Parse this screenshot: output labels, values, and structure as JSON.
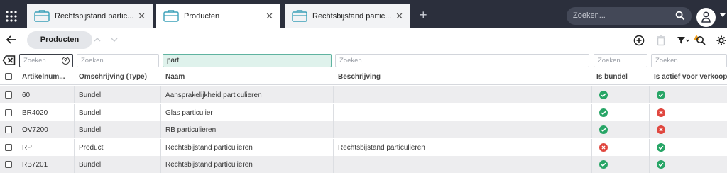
{
  "tabs": [
    {
      "label": "Rechtsbijstand partic...",
      "active": false
    },
    {
      "label": "Producten",
      "active": true
    },
    {
      "label": "Rechtsbijstand partic...",
      "active": false
    }
  ],
  "search": {
    "placeholder": "Zoeken..."
  },
  "toolbar": {
    "title": "Producten"
  },
  "filters": {
    "placeholder": "Zoeken...",
    "naam_value": "part"
  },
  "columns": [
    {
      "label": "Artikelnum..."
    },
    {
      "label": "Omschrijving (Type)"
    },
    {
      "label": "Naam"
    },
    {
      "label": "Beschrijving"
    },
    {
      "label": "Is bundel"
    },
    {
      "label": "Is actief voor verkoop"
    }
  ],
  "rows": [
    {
      "artikelnummer": "60",
      "omschrijving": "Bundel",
      "naam": "Aansprakelijkheid particulieren",
      "beschrijving": "",
      "is_bundel": true,
      "is_actief": true
    },
    {
      "artikelnummer": "BR4020",
      "omschrijving": "Bundel",
      "naam": "Glas particulier",
      "beschrijving": "",
      "is_bundel": true,
      "is_actief": false
    },
    {
      "artikelnummer": "OV7200",
      "omschrijving": "Bundel",
      "naam": "RB particulieren",
      "beschrijving": "",
      "is_bundel": true,
      "is_actief": false
    },
    {
      "artikelnummer": "RP",
      "omschrijving": "Product",
      "naam": "Rechtsbijstand particulieren",
      "beschrijving": "Rechtsbijstand particulieren",
      "is_bundel": false,
      "is_actief": true
    },
    {
      "artikelnummer": "RB7201",
      "omschrijving": "Bundel",
      "naam": "Rechtsbijstand particulieren",
      "beschrijving": "",
      "is_bundel": true,
      "is_actief": true
    }
  ],
  "colors": {
    "topbar": "#2b2f3c",
    "ok": "#27a566",
    "err": "#e0473f",
    "filter_active": "#dff2ec",
    "alert": "#f0a020"
  }
}
